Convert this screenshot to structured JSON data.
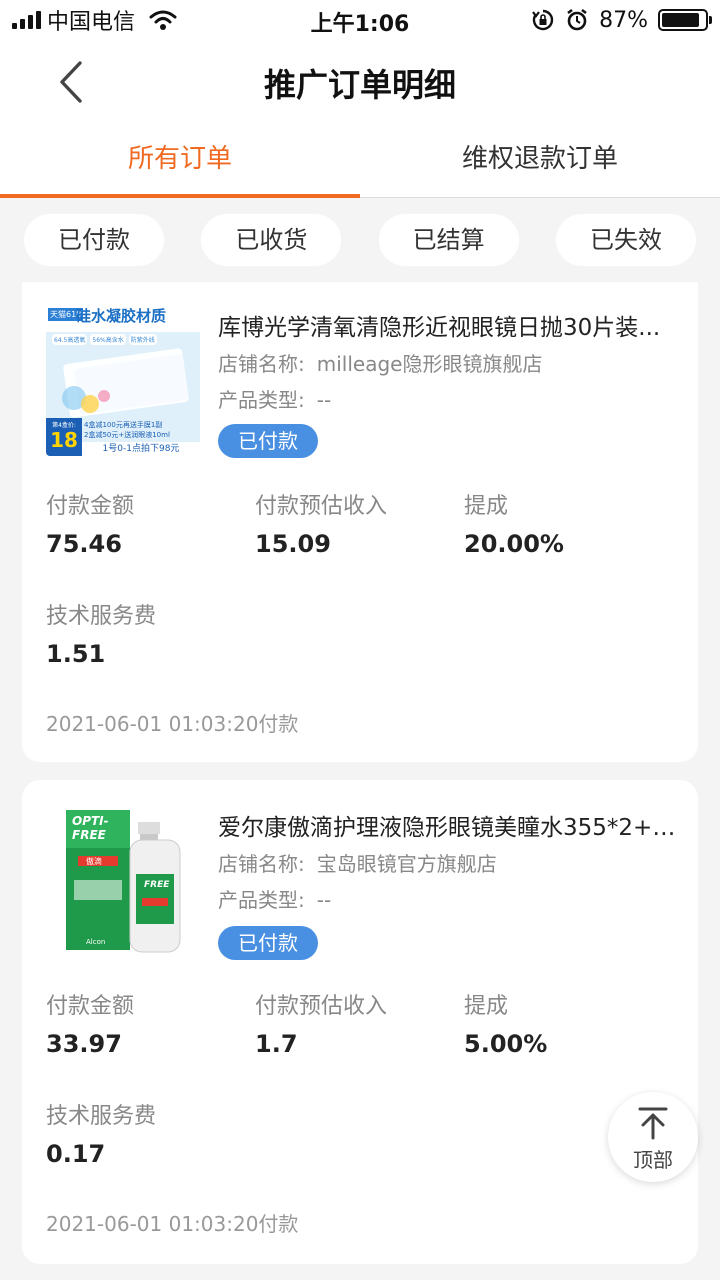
{
  "status_bar": {
    "carrier": "中国电信",
    "time": "上午1:06",
    "battery_percent": "87%",
    "battery_level": 0.87
  },
  "header": {
    "title": "推广订单明细"
  },
  "tabs": [
    {
      "label": "所有订单",
      "active": true
    },
    {
      "label": "维权退款订单",
      "active": false
    }
  ],
  "filters": [
    {
      "label": "已付款"
    },
    {
      "label": "已收货"
    },
    {
      "label": "已结算"
    },
    {
      "label": "已失效"
    }
  ],
  "field_labels": {
    "shop": "店铺名称:",
    "product_type": "产品类型:",
    "pay_amount": "付款金额",
    "est_income": "付款预估收入",
    "commission": "提成",
    "service_fee": "技术服务费"
  },
  "orders": [
    {
      "title": "库博光学清氧清隐形近视眼镜日抛30片装...",
      "shop_name": "milleage隐形眼镜旗舰店",
      "product_type": "--",
      "status": "已付款",
      "pay_amount": "75.46",
      "est_income": "15.09",
      "commission": "20.00%",
      "service_fee": "1.51",
      "timestamp": "2021-06-01 01:03:20付款",
      "thumb": {
        "banner": "硅水凝胶材质",
        "corner_tag": "天猫618",
        "chips": [
          "64.5高透氧",
          "56%高含水",
          "防紫外线"
        ],
        "promo_1": "4盒减100元再送手膜1副",
        "promo_2": "2盒减50元+送润眼液10ml",
        "bottom_text": "1号0-1点拍下98元",
        "price_label": "第4盒价:",
        "price": "18"
      }
    },
    {
      "title": "爱尔康傲滴护理液隐形眼镜美瞳水355*2+6...",
      "shop_name": "宝岛眼镜官方旗舰店",
      "product_type": "--",
      "status": "已付款",
      "pay_amount": "33.97",
      "est_income": "1.7",
      "commission": "5.00%",
      "service_fee": "0.17",
      "timestamp": "2021-06-01 01:03:20付款",
      "thumb": {
        "brand_line1": "OPTI-",
        "brand_line2": "FREE",
        "cn_name": "傲滴",
        "maker": "Alcon"
      }
    }
  ],
  "back_to_top": {
    "label": "顶部"
  }
}
